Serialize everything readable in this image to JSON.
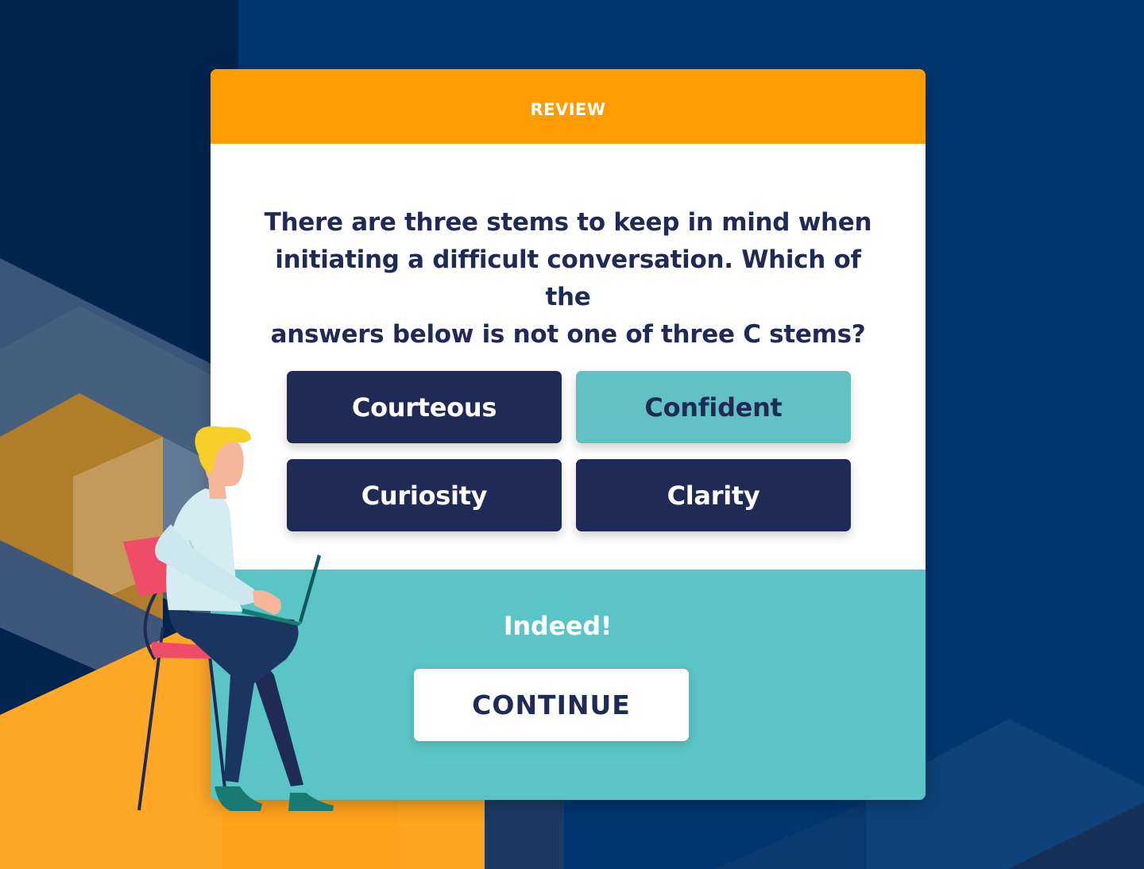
{
  "header": {
    "title": "REVIEW"
  },
  "question": {
    "line1": "There are three stems to keep in mind when",
    "line2": "initiating a difficult conversation.  Which of the",
    "line3": "answers below is not one of three C stems?"
  },
  "answers": [
    {
      "label": "Courteous",
      "selected": false
    },
    {
      "label": "Confident",
      "selected": true
    },
    {
      "label": "Curiosity",
      "selected": false
    },
    {
      "label": "Clarity",
      "selected": false
    }
  ],
  "feedback": {
    "message": "Indeed!",
    "continue_label": "CONTINUE"
  },
  "colors": {
    "accent_orange": "#ff9c00",
    "navy": "#1f2a55",
    "teal": "#5bc4c6",
    "teal_selected": "#62c1c4",
    "background_blue": "#003670"
  },
  "illustration": "person-sitting-with-laptop"
}
